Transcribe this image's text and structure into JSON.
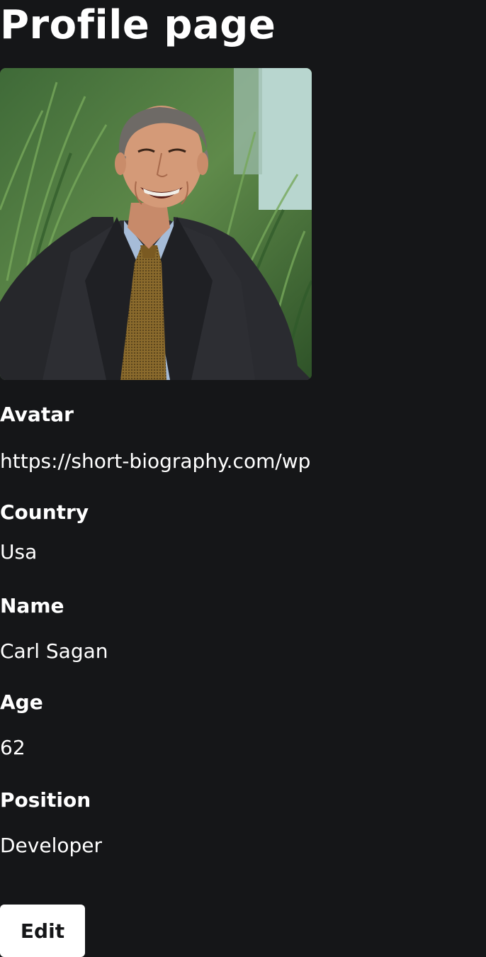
{
  "page": {
    "title": "Profile page"
  },
  "profile": {
    "avatar_image": "portrait of smiling man in dark suit and gold tie in front of green plants",
    "fields": [
      {
        "label": "Avatar",
        "value": "https://short-biography.com/wp"
      },
      {
        "label": "Country",
        "value": "Usa"
      },
      {
        "label": "Name",
        "value": "Carl Sagan"
      },
      {
        "label": "Age",
        "value": "62"
      },
      {
        "label": "Position",
        "value": "Developer"
      }
    ]
  },
  "actions": {
    "edit_label": "Edit"
  },
  "colors": {
    "background": "#151618",
    "text": "#ffffff",
    "button_bg": "#ffffff",
    "button_text": "#151618"
  }
}
